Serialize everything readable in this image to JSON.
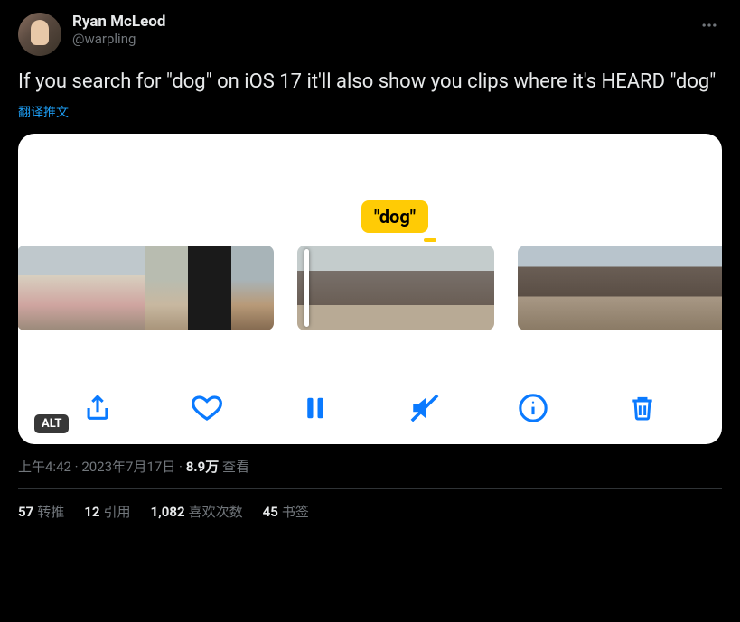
{
  "author": {
    "display_name": "Ryan McLeod",
    "handle": "@warpling"
  },
  "tweet_text": "If you search for \"dog\" on iOS 17 it'll also show you clips where it's HEARD \"dog\"",
  "translate_label": "翻译推文",
  "media": {
    "tooltip_text": "\"dog\"",
    "alt_badge": "ALT"
  },
  "meta": {
    "time": "上午4:42",
    "date": "2023年7月17日",
    "views_count": "8.9万",
    "views_label": "查看",
    "separator": " · "
  },
  "stats": {
    "retweets": {
      "count": "57",
      "label": "转推"
    },
    "quotes": {
      "count": "12",
      "label": "引用"
    },
    "likes": {
      "count": "1,082",
      "label": "喜欢次数"
    },
    "bookmarks": {
      "count": "45",
      "label": "书签"
    }
  }
}
